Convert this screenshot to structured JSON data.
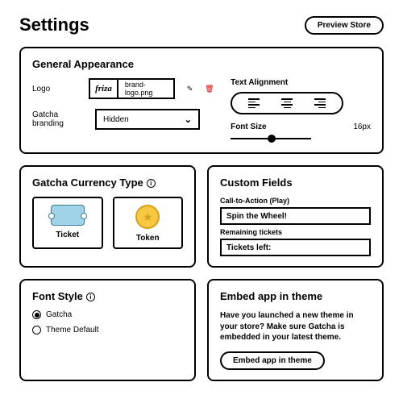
{
  "header": {
    "title": "Settings",
    "preview_btn": "Preview Store"
  },
  "general": {
    "title": "General Appearance",
    "logo_label": "Logo",
    "logo_text": "friza",
    "logo_filename": "brand-logo.png",
    "branding_label": "Gatcha branding",
    "branding_value": "Hidden",
    "text_align_label": "Text Alignment",
    "font_size_label": "Font Size",
    "font_size_value": "16px"
  },
  "currency": {
    "title": "Gatcha Currency Type",
    "opt1": "Ticket",
    "opt2": "Token"
  },
  "custom_fields": {
    "title": "Custom Fields",
    "cta_label": "Call-to-Action (Play)",
    "cta_value": "Spin the Wheel!",
    "remaining_label": "Remaining tickets",
    "remaining_value": "Tickets left:"
  },
  "font_style": {
    "title": "Font Style",
    "opt1": "Gatcha",
    "opt2": "Theme Default"
  },
  "embed": {
    "title": "Embed app in theme",
    "body": "Have you launched a new theme in your store? Make sure Gatcha is embedded in your latest theme.",
    "button": "Embed app in theme"
  }
}
